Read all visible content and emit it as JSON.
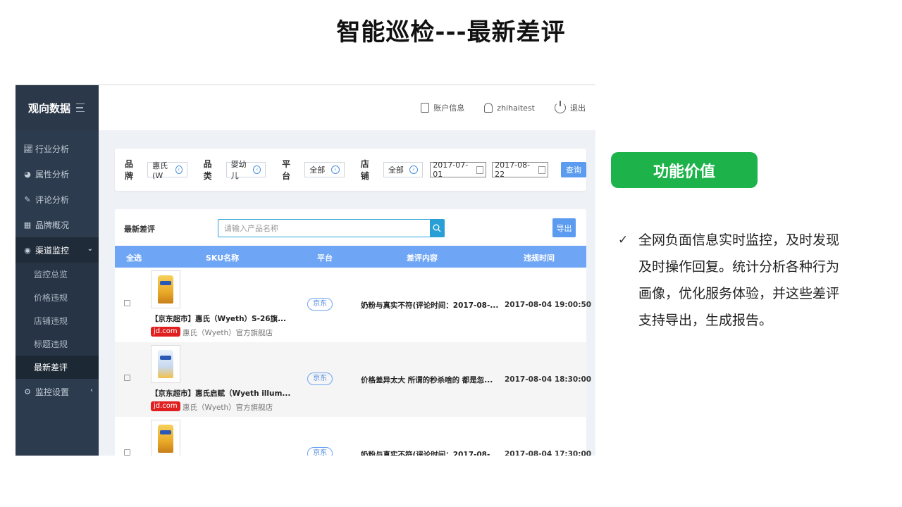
{
  "slide_title": "智能巡检---最新差评",
  "sidebar": {
    "brand": "观向数据",
    "items": [
      {
        "label": "行业分析",
        "icon": "line-chart-icon"
      },
      {
        "label": "属性分析",
        "icon": "pie-chart-icon"
      },
      {
        "label": "评论分析",
        "icon": "edit-icon"
      },
      {
        "label": "品牌概况",
        "icon": "building-icon"
      },
      {
        "label": "渠道监控",
        "icon": "target-icon",
        "active": true
      },
      {
        "label": "监控设置",
        "icon": "gear-icon"
      }
    ],
    "sub_items": [
      "监控总览",
      "价格违规",
      "店铺违规",
      "标题违规",
      "最新差评"
    ],
    "active_sub": "最新差评"
  },
  "topbar": {
    "account": "账户信息",
    "user": "zhihaitest",
    "logout": "退出"
  },
  "filters": {
    "brand_label": "品牌",
    "brand_value": "惠氏(W",
    "category_label": "品类",
    "category_value": "婴幼儿",
    "platform_label": "平台",
    "platform_value": "全部",
    "store_label": "店铺",
    "store_value": "全部",
    "date_from": "2017-07-01",
    "date_to": "2017-08-22",
    "query_button": "查询"
  },
  "list": {
    "title": "最新差评",
    "search_placeholder": "请输入产品名称",
    "export_button": "导出",
    "columns": [
      "全选",
      "SKU名称",
      "平台",
      "差评内容",
      "违规时间"
    ],
    "rows": [
      {
        "sku": "【京东超市】惠氏（Wyeth）S-26旗...",
        "badge": "jd.com",
        "shop": "惠氏（Wyeth）官方旗舰店",
        "platform": "京东",
        "review": "奶粉与真实不符(评论时间：2017-08-...",
        "time": "2017-08-04 19:00:50"
      },
      {
        "sku": "【京东超市】惠氏启赋（Wyeth illum...",
        "badge": "jd.com",
        "shop": "惠氏（Wyeth）官方旗舰店",
        "platform": "京东",
        "review": "价格差异太大 所谓的秒杀啥的 都是忽...",
        "time": "2017-08-04 18:30:00"
      },
      {
        "sku": "",
        "badge": "",
        "shop": "",
        "platform": "京东",
        "review": "奶粉与真实不符(评论时间：2017-08-...",
        "time": "2017-08-04 17:30:00"
      }
    ]
  },
  "value_panel": {
    "badge": "功能价值",
    "check": "✓",
    "text": "全网负面信息实时监控，及时发现及时操作回复。统计分析各种行为画像，优化服务体验，并这些差评支持导出，生成报告。"
  },
  "colors": {
    "sidebar_bg": "#2c3b4d",
    "table_header": "#6fa5f5",
    "primary_button": "#5b9cf0",
    "badge_green": "#1db34a",
    "jd_red": "#e02020"
  }
}
